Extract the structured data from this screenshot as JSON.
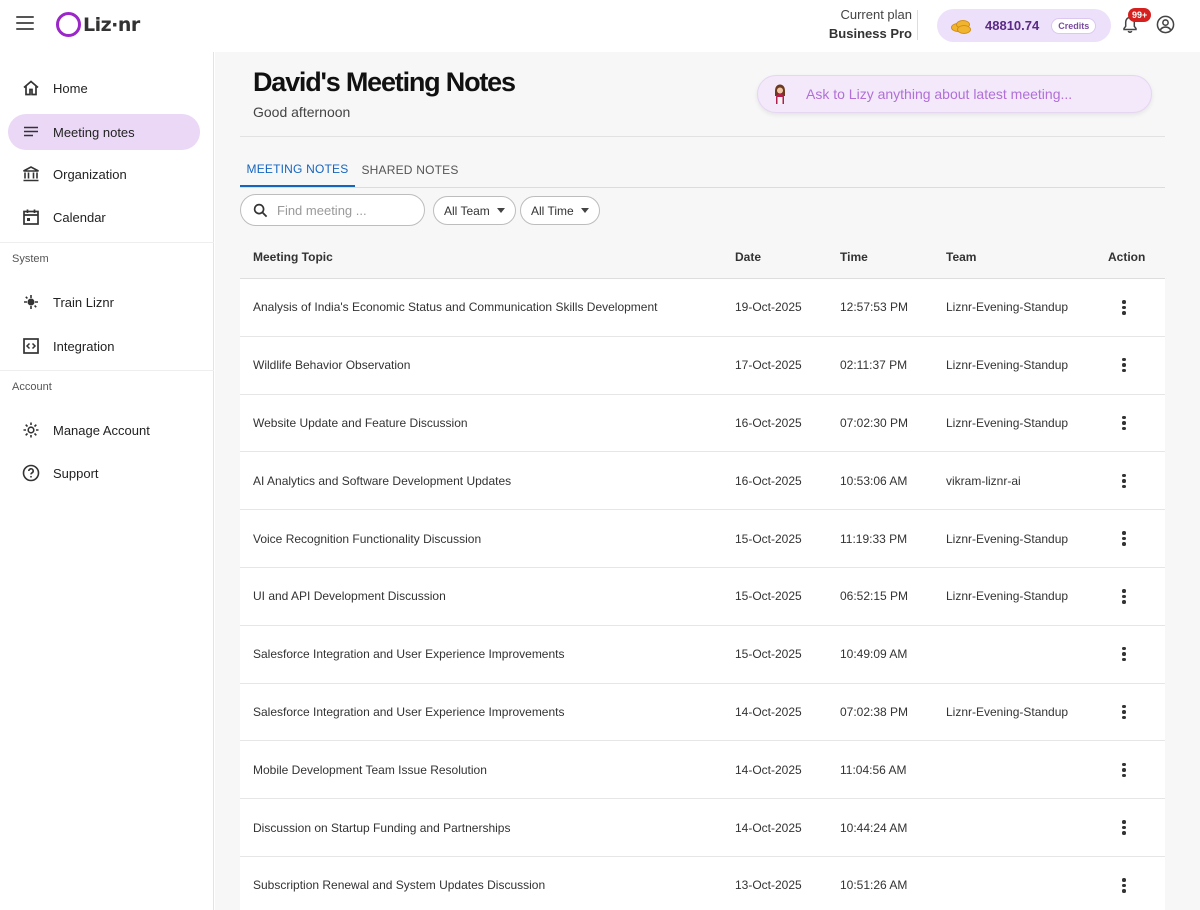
{
  "app": {
    "logo_text": "Liz·nr"
  },
  "header": {
    "plan_label": "Current plan",
    "plan_value": "Business Pro",
    "credits_value": "48810.74",
    "credits_label": "Credits",
    "notifications_badge": "99+"
  },
  "sidebar": {
    "items": [
      {
        "label": "Home",
        "icon": "home-icon"
      },
      {
        "label": "Meeting notes",
        "icon": "notes-icon",
        "active": true
      },
      {
        "label": "Organization",
        "icon": "organization-icon"
      },
      {
        "label": "Calendar",
        "icon": "calendar-icon"
      }
    ],
    "system_section": "System",
    "system_items": [
      {
        "label": "Train Liznr",
        "icon": "train-icon"
      },
      {
        "label": "Integration",
        "icon": "integration-icon"
      }
    ],
    "account_section": "Account",
    "account_items": [
      {
        "label": "Manage Account",
        "icon": "settings-icon"
      },
      {
        "label": "Support",
        "icon": "help-icon"
      }
    ]
  },
  "main": {
    "title": "David's Meeting Notes",
    "greeting": "Good afternoon",
    "ask_placeholder": "Ask to Lizy anything about latest meeting...",
    "tabs": [
      {
        "label": "MEETING NOTES",
        "active": true
      },
      {
        "label": "SHARED NOTES",
        "active": false
      }
    ],
    "search_placeholder": "Find meeting ...",
    "filters": [
      "All Team",
      "All Time"
    ]
  },
  "table": {
    "columns": [
      "Meeting Topic",
      "Date",
      "Time",
      "Team",
      "Action"
    ],
    "rows": [
      {
        "topic": "Analysis of India's Economic Status and Communication Skills Development",
        "date": "19-Oct-2025",
        "time": "12:57:53 PM",
        "team": "Liznr-Evening-Standup"
      },
      {
        "topic": "Wildlife Behavior Observation",
        "date": "17-Oct-2025",
        "time": "02:11:37 PM",
        "team": "Liznr-Evening-Standup"
      },
      {
        "topic": "Website Update and Feature Discussion",
        "date": "16-Oct-2025",
        "time": "07:02:30 PM",
        "team": "Liznr-Evening-Standup"
      },
      {
        "topic": "AI Analytics and Software Development Updates",
        "date": "16-Oct-2025",
        "time": "10:53:06 AM",
        "team": "vikram-liznr-ai"
      },
      {
        "topic": "Voice Recognition Functionality Discussion",
        "date": "15-Oct-2025",
        "time": "11:19:33 PM",
        "team": "Liznr-Evening-Standup"
      },
      {
        "topic": "UI and API Development Discussion",
        "date": "15-Oct-2025",
        "time": "06:52:15 PM",
        "team": "Liznr-Evening-Standup"
      },
      {
        "topic": "Salesforce Integration and User Experience Improvements",
        "date": "15-Oct-2025",
        "time": "10:49:09 AM",
        "team": ""
      },
      {
        "topic": "Salesforce Integration and User Experience Improvements",
        "date": "14-Oct-2025",
        "time": "07:02:38 PM",
        "team": "Liznr-Evening-Standup"
      },
      {
        "topic": "Mobile Development Team Issue Resolution",
        "date": "14-Oct-2025",
        "time": "11:04:56 AM",
        "team": ""
      },
      {
        "topic": "Discussion on Startup Funding and Partnerships",
        "date": "14-Oct-2025",
        "time": "10:44:24 AM",
        "team": ""
      },
      {
        "topic": "Subscription Renewal and System Updates Discussion",
        "date": "13-Oct-2025",
        "time": "10:51:26 AM",
        "team": ""
      }
    ]
  },
  "colors": {
    "accent": "#9b27c9",
    "active_nav": "#ead8f6",
    "tab_active": "#1565c0",
    "credits_bg": "#ede0fa"
  }
}
